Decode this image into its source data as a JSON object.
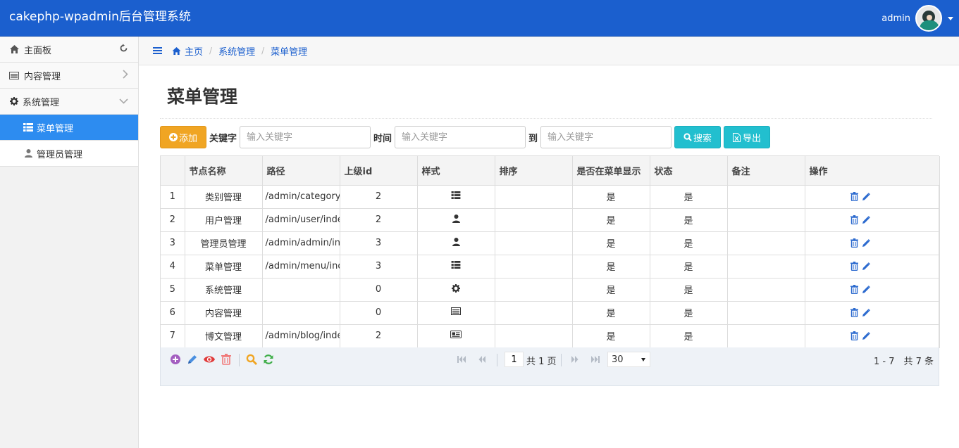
{
  "app": {
    "title": "cakephp-wpadmin后台管理系统",
    "user": "admin"
  },
  "sidebar": {
    "items": [
      {
        "label": "主面板",
        "icon": "home-icon",
        "right_icon": "refresh-icon"
      },
      {
        "label": "内容管理",
        "icon": "list-alt-icon",
        "right_icon": "chevron-right-icon"
      },
      {
        "label": "系统管理",
        "icon": "gear-icon",
        "right_icon": "chevron-down-icon"
      }
    ],
    "subitems": [
      {
        "label": "菜单管理",
        "icon": "th-list-icon",
        "active": true
      },
      {
        "label": "管理员管理",
        "icon": "user-icon",
        "active": false
      }
    ]
  },
  "breadcrumb": {
    "home": "主页",
    "level1": "系统管理",
    "level2": "菜单管理",
    "separator": "/"
  },
  "page": {
    "title": "菜单管理"
  },
  "toolbar": {
    "add_label": "添加",
    "keyword_label": "关键字",
    "keyword_placeholder": "输入关键字",
    "time_label": "时间",
    "time_from_placeholder": "输入关键字",
    "to_label": "到",
    "time_to_placeholder": "输入关键字",
    "search_label": "搜索",
    "export_label": "导出"
  },
  "table": {
    "columns": [
      "",
      "节点名称",
      "路径",
      "上级id",
      "样式",
      "排序",
      "是否在菜单显示",
      "状态",
      "备注",
      "操作"
    ],
    "rows": [
      {
        "no": "1",
        "name": "类别管理",
        "path": "/admin/category/index",
        "parent": "2",
        "style": "th-list-icon",
        "sort": "",
        "show": "是",
        "status": "是",
        "remark": ""
      },
      {
        "no": "2",
        "name": "用户管理",
        "path": "/admin/user/index",
        "parent": "2",
        "style": "user-icon",
        "sort": "",
        "show": "是",
        "status": "是",
        "remark": ""
      },
      {
        "no": "3",
        "name": "管理员管理",
        "path": "/admin/admin/index",
        "parent": "3",
        "style": "user-icon",
        "sort": "",
        "show": "是",
        "status": "是",
        "remark": ""
      },
      {
        "no": "4",
        "name": "菜单管理",
        "path": "/admin/menu/index",
        "parent": "3",
        "style": "th-list-icon",
        "sort": "",
        "show": "是",
        "status": "是",
        "remark": ""
      },
      {
        "no": "5",
        "name": "系统管理",
        "path": "",
        "parent": "0",
        "style": "gear-icon",
        "sort": "",
        "show": "是",
        "status": "是",
        "remark": ""
      },
      {
        "no": "6",
        "name": "内容管理",
        "path": "",
        "parent": "0",
        "style": "list-alt-icon",
        "sort": "",
        "show": "是",
        "status": "是",
        "remark": ""
      },
      {
        "no": "7",
        "name": "博文管理",
        "path": "/admin/blog/index",
        "parent": "2",
        "style": "newspaper-icon",
        "sort": "",
        "show": "是",
        "status": "是",
        "remark": ""
      }
    ]
  },
  "pager": {
    "page": "1",
    "total_pages_text": "共 1 页",
    "page_size": "30",
    "summary": "1 - 7　共 7 条"
  },
  "colors": {
    "navbar": "#1b5fce",
    "active_menu": "#2d8cf0",
    "add_button": "#f0a523",
    "search_button": "#22bfcf",
    "op_icon": "#2d6bcf"
  }
}
